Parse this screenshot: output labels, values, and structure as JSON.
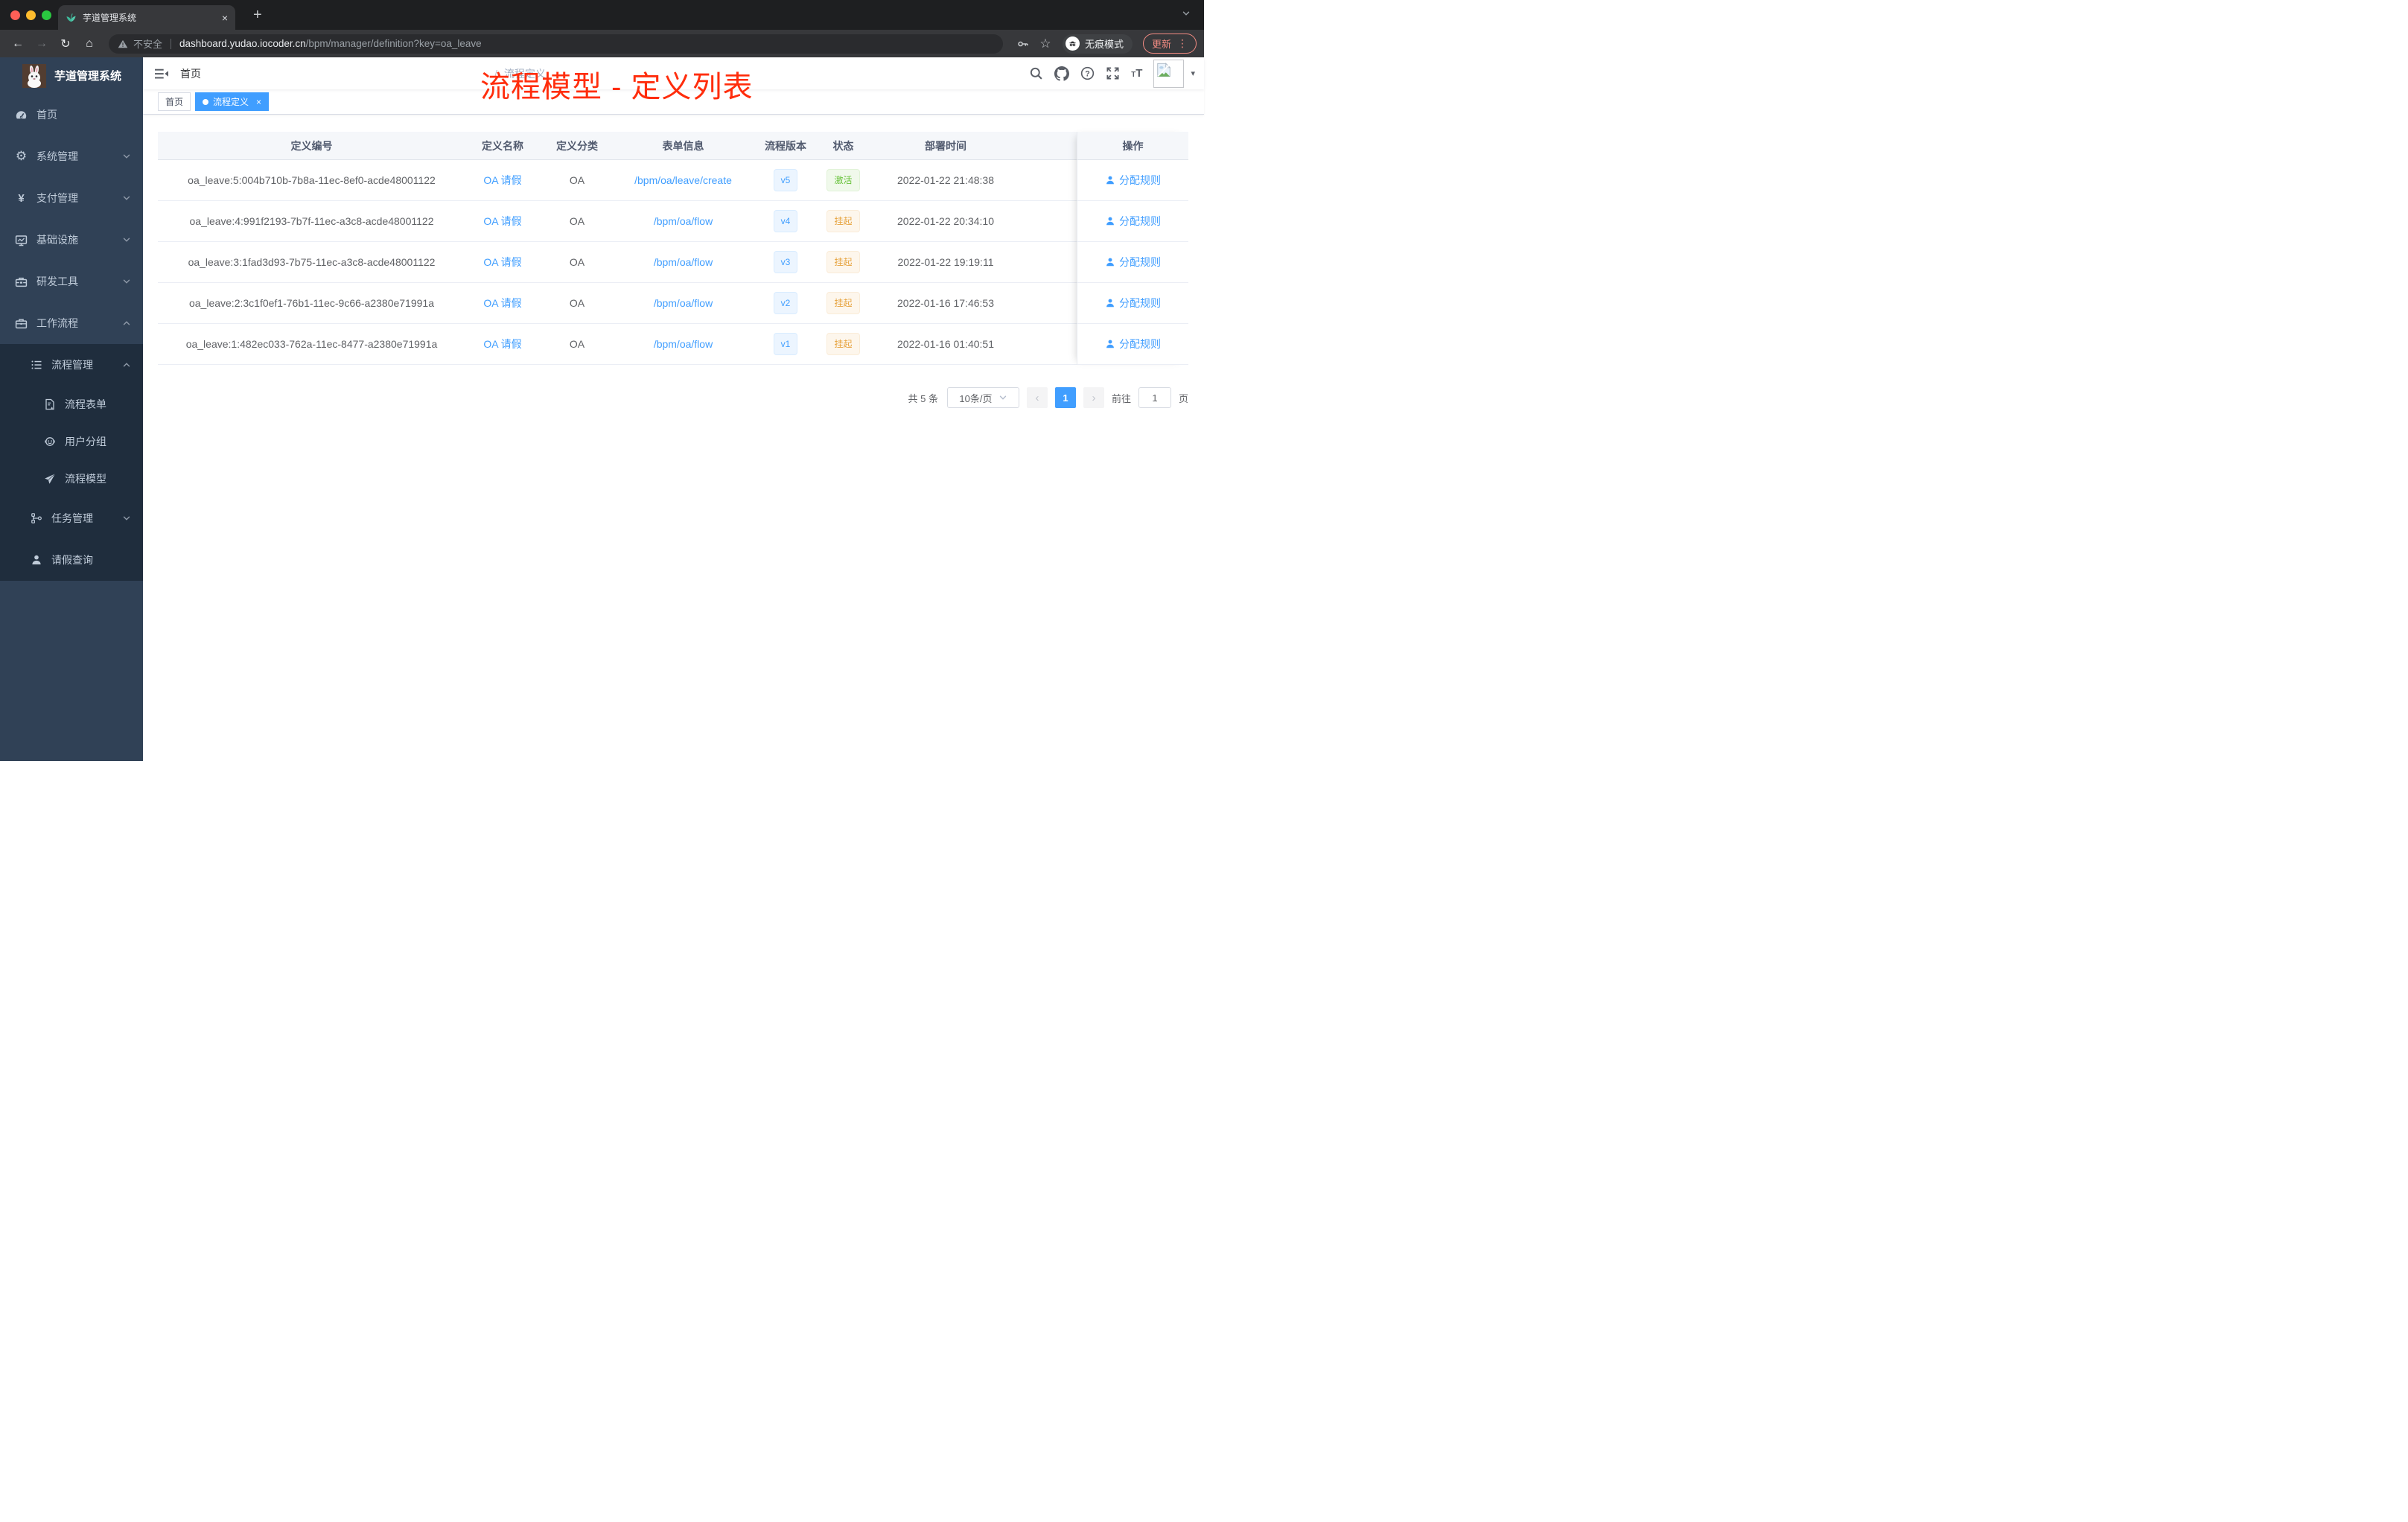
{
  "browser": {
    "tab_title": "芋道管理系统",
    "security_label": "不安全",
    "url_host": "dashboard.yudao.iocoder.cn",
    "url_path": "/bpm/manager/definition?key=oa_leave",
    "incognito_label": "无痕模式",
    "update_label": "更新"
  },
  "icons": {
    "close": "×",
    "plus": "+",
    "dots": "⋮",
    "back": "←",
    "forward": "→",
    "refresh": "↻",
    "home": "⌂",
    "star": "☆",
    "gear": "⚙",
    "yen": "¥",
    "caret_down": "▾",
    "question": "?",
    "text_small": "T",
    "text_big": "T",
    "prev": "‹",
    "next": "›"
  },
  "sidebar": {
    "logo_title": "芋道管理系统",
    "items": [
      {
        "label": "首页",
        "icon": "dashboard-icon"
      },
      {
        "label": "系统管理",
        "icon": "gear-icon",
        "chevron": "down"
      },
      {
        "label": "支付管理",
        "icon": "yen-icon",
        "chevron": "down"
      },
      {
        "label": "基础设施",
        "icon": "monitor-icon",
        "chevron": "down"
      },
      {
        "label": "研发工具",
        "icon": "toolbox-icon",
        "chevron": "down"
      },
      {
        "label": "工作流程",
        "icon": "briefcase-icon",
        "chevron": "up",
        "expanded": true
      }
    ],
    "workflow_submenu": [
      {
        "label": "流程管理",
        "icon": "list-icon",
        "chevron": "up",
        "expanded": true
      },
      {
        "label": "流程表单",
        "icon": "form-icon",
        "level": 3
      },
      {
        "label": "用户分组",
        "icon": "user-group-icon",
        "level": 3
      },
      {
        "label": "流程模型",
        "icon": "paper-plane-icon",
        "level": 3
      },
      {
        "label": "任务管理",
        "icon": "tree-icon",
        "chevron": "down"
      },
      {
        "label": "请假查询",
        "icon": "person-icon"
      }
    ]
  },
  "navbar": {
    "breadcrumb": {
      "home": "首页",
      "sep": "/",
      "current": "流程定义"
    }
  },
  "annotation": {
    "text": "流程模型 - 定义列表",
    "color": "#ff2d0c"
  },
  "tags": {
    "home": "首页",
    "active": "流程定义"
  },
  "table": {
    "columns": [
      "定义编号",
      "定义名称",
      "定义分类",
      "表单信息",
      "流程版本",
      "状态",
      "部署时间",
      "操作"
    ],
    "action_label": "分配规则",
    "rows": [
      {
        "id": "oa_leave:5:004b710b-7b8a-11ec-8ef0-acde48001122",
        "name": "OA 请假",
        "category": "OA",
        "form": "/bpm/oa/leave/create",
        "version": "v5",
        "status": "激活",
        "status_type": "active",
        "deploy_time": "2022-01-22 21:48:38",
        "action": "分配规则"
      },
      {
        "id": "oa_leave:4:991f2193-7b7f-11ec-a3c8-acde48001122",
        "name": "OA 请假",
        "category": "OA",
        "form": "/bpm/oa/flow",
        "version": "v4",
        "status": "挂起",
        "status_type": "suspend",
        "deploy_time": "2022-01-22 20:34:10",
        "action": "分配规则"
      },
      {
        "id": "oa_leave:3:1fad3d93-7b75-11ec-a3c8-acde48001122",
        "name": "OA 请假",
        "category": "OA",
        "form": "/bpm/oa/flow",
        "version": "v3",
        "status": "挂起",
        "status_type": "suspend",
        "deploy_time": "2022-01-22 19:19:11",
        "action": "分配规则"
      },
      {
        "id": "oa_leave:2:3c1f0ef1-76b1-11ec-9c66-a2380e71991a",
        "name": "OA 请假",
        "category": "OA",
        "form": "/bpm/oa/flow",
        "version": "v2",
        "status": "挂起",
        "status_type": "suspend",
        "deploy_time": "2022-01-16 17:46:53",
        "action": "分配规则"
      },
      {
        "id": "oa_leave:1:482ec033-762a-11ec-8477-a2380e71991a",
        "name": "OA 请假",
        "category": "OA",
        "form": "/bpm/oa/flow",
        "version": "v1",
        "status": "挂起",
        "status_type": "suspend",
        "deploy_time": "2022-01-16 01:40:51",
        "action": "分配规则"
      }
    ]
  },
  "pagination": {
    "total": "共 5 条",
    "page_size": "10条/页",
    "current_page": "1",
    "goto_label": "前往",
    "goto_value": "1",
    "page_suffix": "页"
  }
}
